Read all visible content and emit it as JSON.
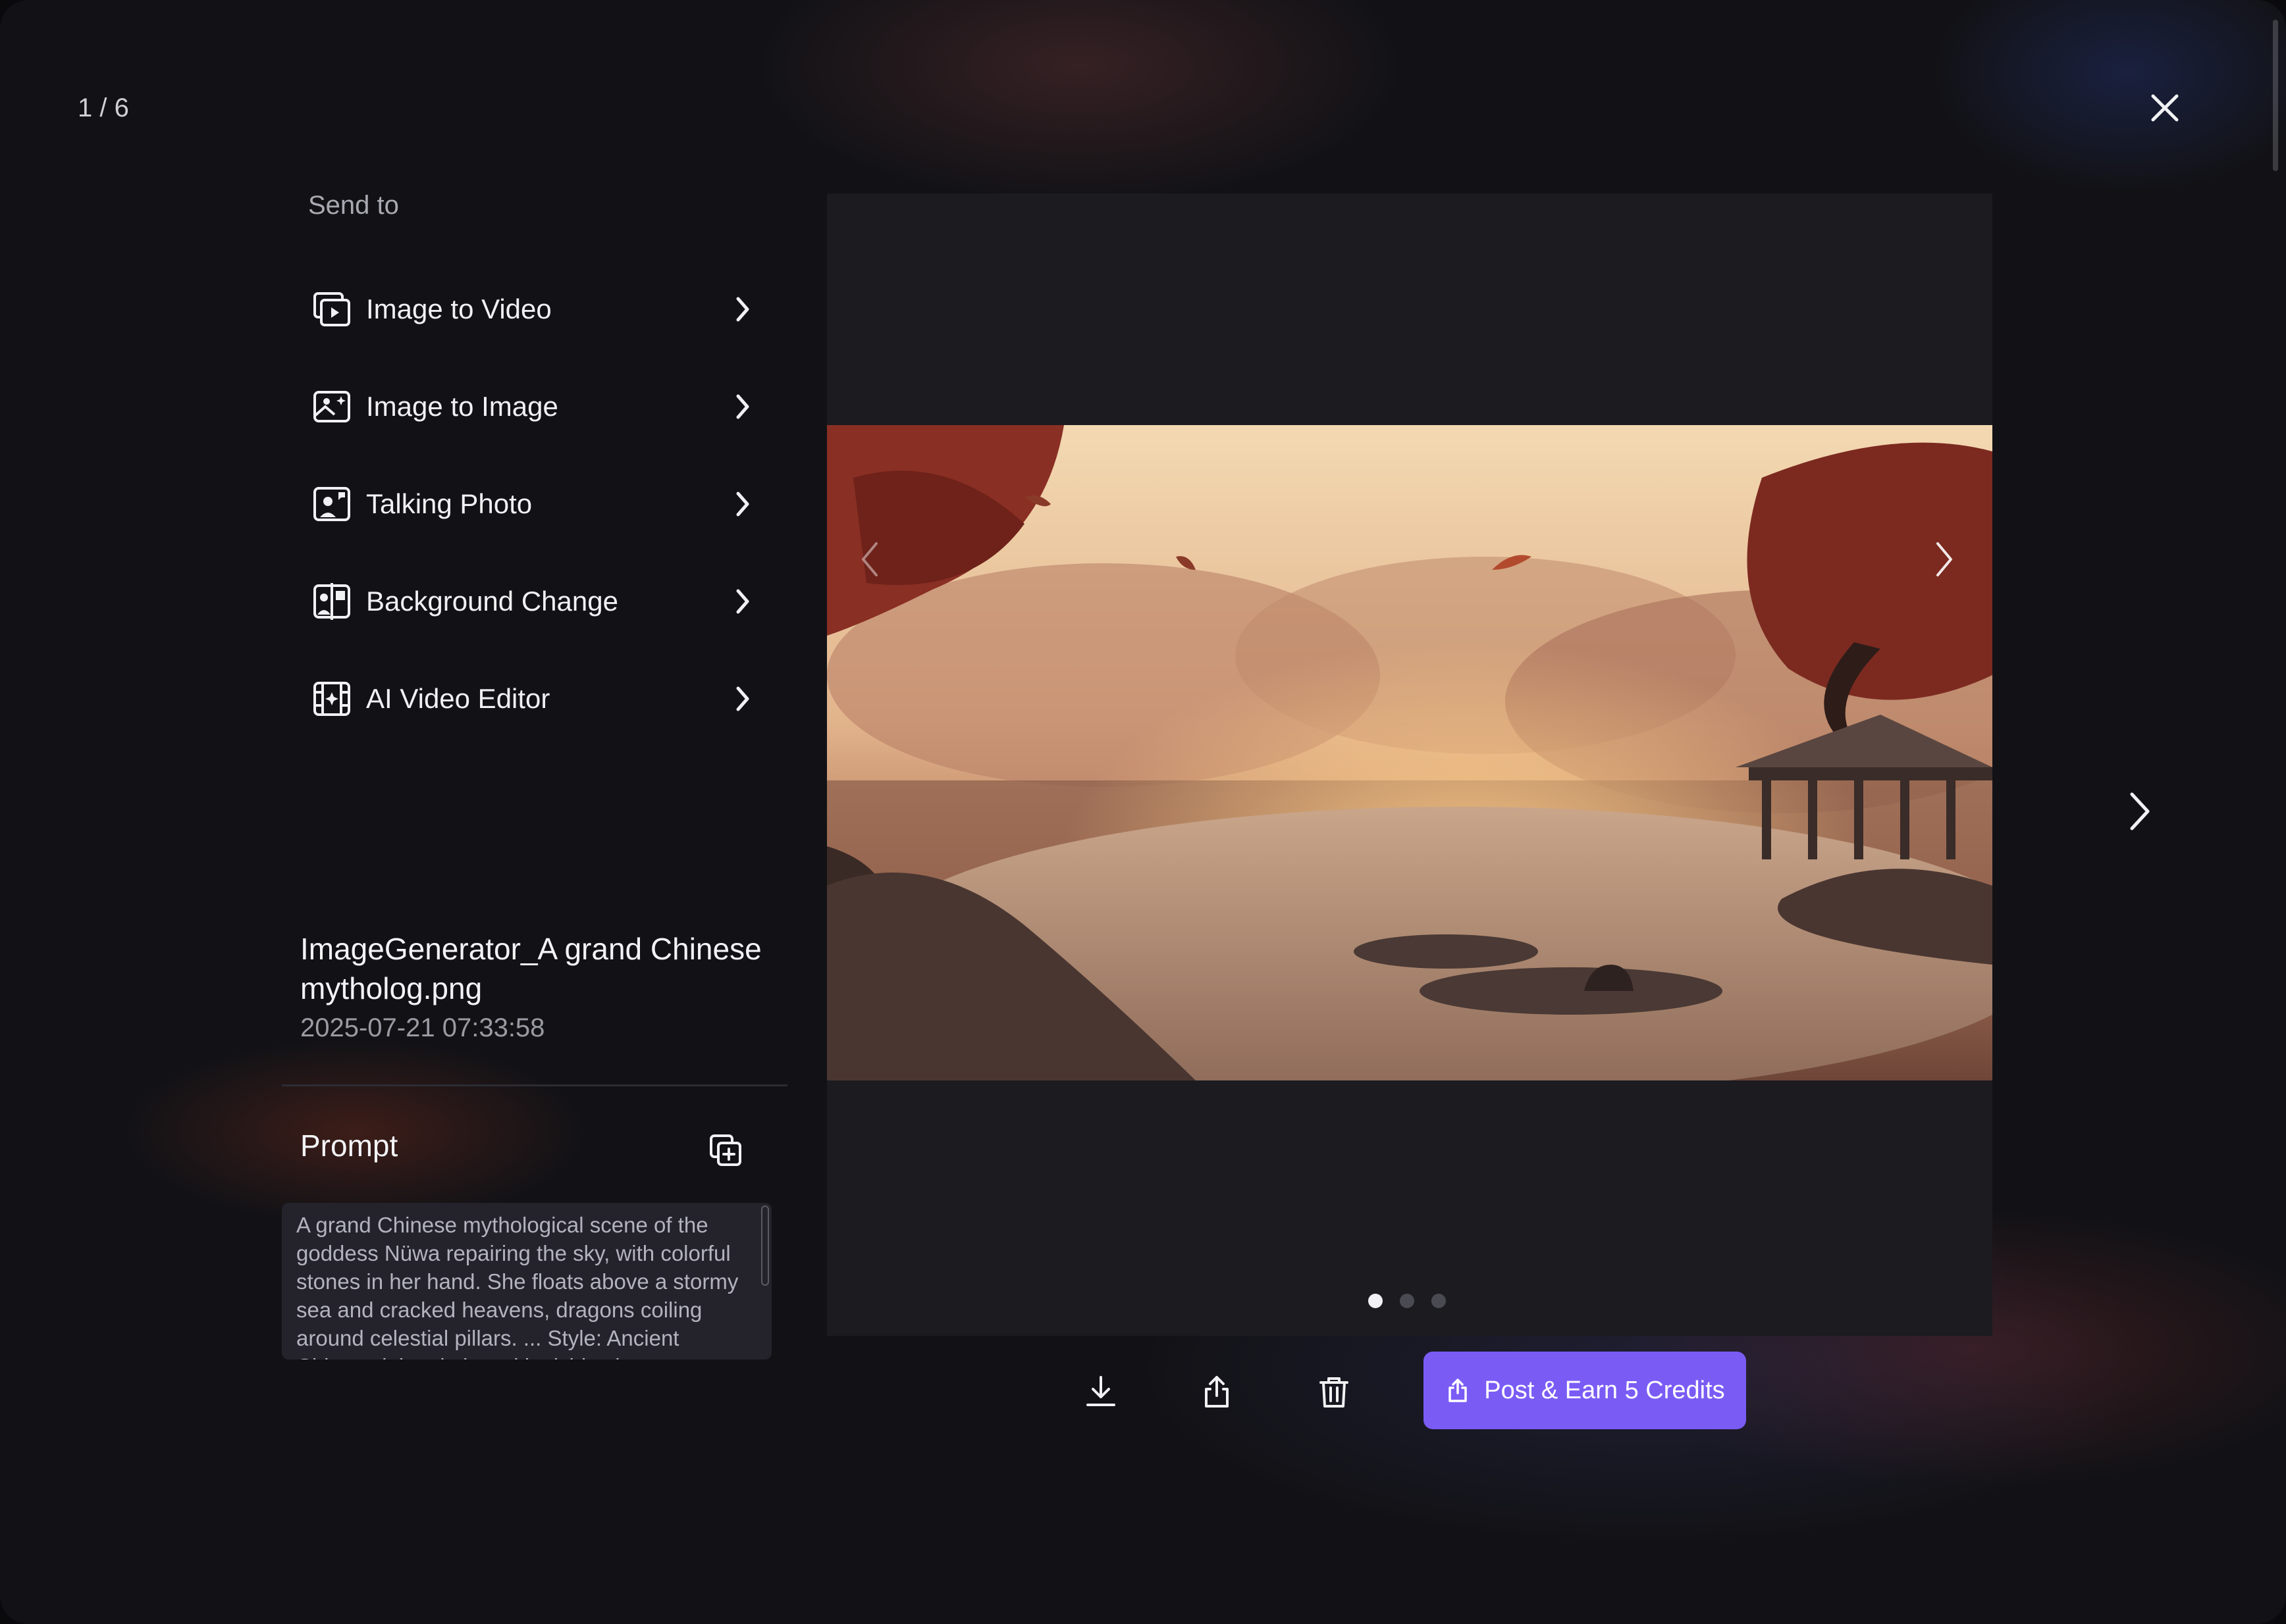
{
  "header": {
    "counter": "1 / 6"
  },
  "sidebar": {
    "section_title": "Send to",
    "items": [
      {
        "label": "Image to Video",
        "icon": "image-to-video-icon"
      },
      {
        "label": "Image to Image",
        "icon": "image-to-image-icon"
      },
      {
        "label": "Talking Photo",
        "icon": "talking-photo-icon"
      },
      {
        "label": "Background Change",
        "icon": "background-change-icon"
      },
      {
        "label": "AI Video Editor",
        "icon": "ai-video-editor-icon"
      }
    ]
  },
  "file": {
    "name": "ImageGenerator_A grand Chinese mytholog.png",
    "date": "2025-07-21 07:33:58"
  },
  "prompt": {
    "title": "Prompt",
    "text": "A grand Chinese mythological scene of the goddess Nüwa repairing the sky, with colorful stones in her hand. She floats above a stormy sea and cracked heavens, dragons coiling around celestial pillars. ... Style: Ancient Chinese ink painting with vivid colors"
  },
  "viewer": {
    "pagination": {
      "total": 3,
      "active": 0
    }
  },
  "toolbar": {
    "post_label": "Post & Earn 5 Credits"
  },
  "colors": {
    "accent": "#7a5cf5",
    "background": "#121216",
    "panel": "#1b1b20"
  }
}
